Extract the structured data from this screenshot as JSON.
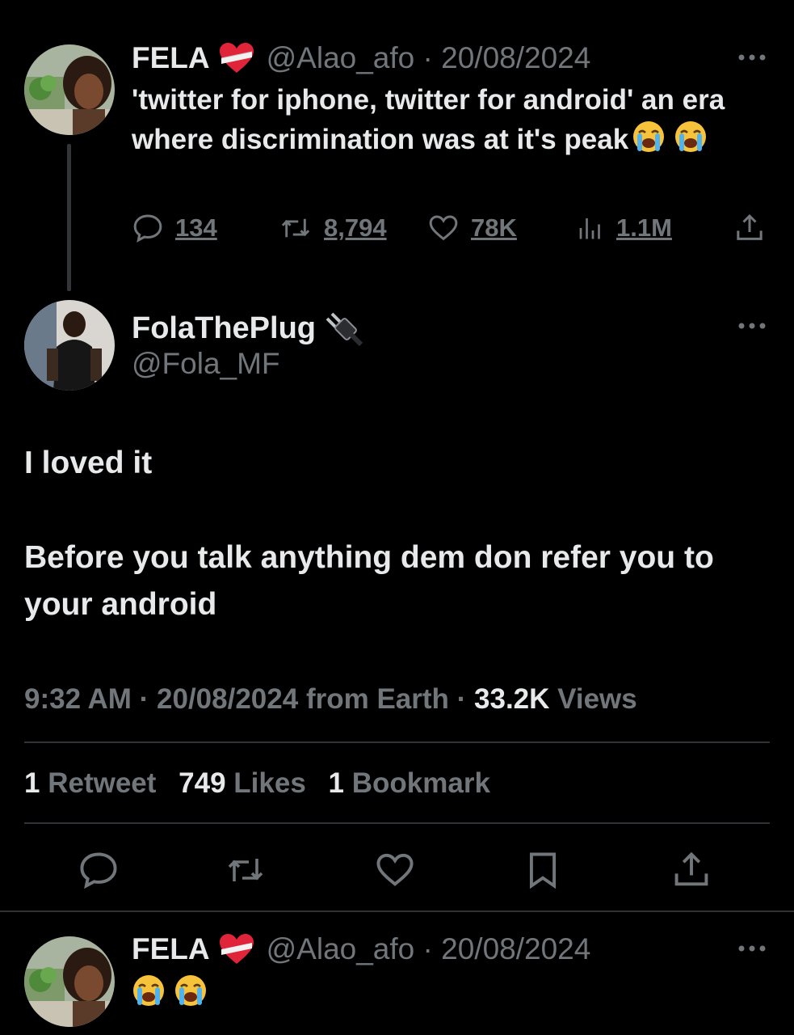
{
  "quoted_tweet": {
    "name": "FELA",
    "handle": "@Alao_afo",
    "date": "20/08/2024",
    "text": "'twitter for iphone, twitter for android' an era where discrimination was at it's peak",
    "replies": "134",
    "retweets": "8,794",
    "likes": "78K",
    "views": "1.1M"
  },
  "main_tweet": {
    "name": "FolaThePlug",
    "handle": "@Fola_MF",
    "text_line1": "I loved it",
    "text_line2": "Before you talk anything dem don refer you to your android",
    "time": "9:32 AM",
    "date": "20/08/2024",
    "source": "from Earth",
    "views_count": "33.2K",
    "views_label": "Views",
    "retweet_count": "1",
    "retweet_label": "Retweet",
    "likes_count": "749",
    "likes_label": "Likes",
    "bookmark_count": "1",
    "bookmark_label": "Bookmark"
  },
  "reply_tweet": {
    "name": "FELA",
    "handle": "@Alao_afo",
    "date": "20/08/2024"
  },
  "icons": {
    "verified_style": "heart-with-ribbon-icon",
    "crying": "loudly-crying-face-icon",
    "plug": "electric-plug-icon"
  },
  "colors": {
    "background": "#000000",
    "text": "#e7e9ea",
    "muted": "#71767b",
    "divider": "#2f3336"
  }
}
